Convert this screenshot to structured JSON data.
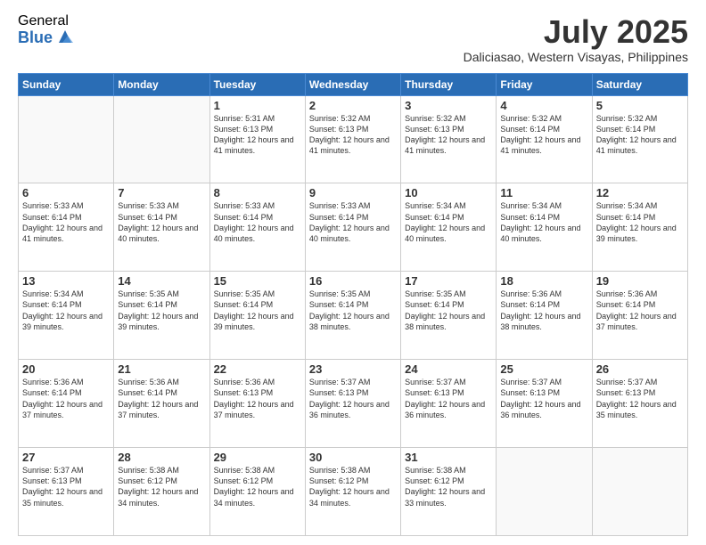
{
  "logo": {
    "general": "General",
    "blue": "Blue"
  },
  "title": {
    "month_year": "July 2025",
    "location": "Daliciasao, Western Visayas, Philippines"
  },
  "days_of_week": [
    "Sunday",
    "Monday",
    "Tuesday",
    "Wednesday",
    "Thursday",
    "Friday",
    "Saturday"
  ],
  "weeks": [
    [
      {
        "day": "",
        "sunrise": "",
        "sunset": "",
        "daylight": ""
      },
      {
        "day": "",
        "sunrise": "",
        "sunset": "",
        "daylight": ""
      },
      {
        "day": "1",
        "sunrise": "Sunrise: 5:31 AM",
        "sunset": "Sunset: 6:13 PM",
        "daylight": "Daylight: 12 hours and 41 minutes."
      },
      {
        "day": "2",
        "sunrise": "Sunrise: 5:32 AM",
        "sunset": "Sunset: 6:13 PM",
        "daylight": "Daylight: 12 hours and 41 minutes."
      },
      {
        "day": "3",
        "sunrise": "Sunrise: 5:32 AM",
        "sunset": "Sunset: 6:13 PM",
        "daylight": "Daylight: 12 hours and 41 minutes."
      },
      {
        "day": "4",
        "sunrise": "Sunrise: 5:32 AM",
        "sunset": "Sunset: 6:14 PM",
        "daylight": "Daylight: 12 hours and 41 minutes."
      },
      {
        "day": "5",
        "sunrise": "Sunrise: 5:32 AM",
        "sunset": "Sunset: 6:14 PM",
        "daylight": "Daylight: 12 hours and 41 minutes."
      }
    ],
    [
      {
        "day": "6",
        "sunrise": "Sunrise: 5:33 AM",
        "sunset": "Sunset: 6:14 PM",
        "daylight": "Daylight: 12 hours and 41 minutes."
      },
      {
        "day": "7",
        "sunrise": "Sunrise: 5:33 AM",
        "sunset": "Sunset: 6:14 PM",
        "daylight": "Daylight: 12 hours and 40 minutes."
      },
      {
        "day": "8",
        "sunrise": "Sunrise: 5:33 AM",
        "sunset": "Sunset: 6:14 PM",
        "daylight": "Daylight: 12 hours and 40 minutes."
      },
      {
        "day": "9",
        "sunrise": "Sunrise: 5:33 AM",
        "sunset": "Sunset: 6:14 PM",
        "daylight": "Daylight: 12 hours and 40 minutes."
      },
      {
        "day": "10",
        "sunrise": "Sunrise: 5:34 AM",
        "sunset": "Sunset: 6:14 PM",
        "daylight": "Daylight: 12 hours and 40 minutes."
      },
      {
        "day": "11",
        "sunrise": "Sunrise: 5:34 AM",
        "sunset": "Sunset: 6:14 PM",
        "daylight": "Daylight: 12 hours and 40 minutes."
      },
      {
        "day": "12",
        "sunrise": "Sunrise: 5:34 AM",
        "sunset": "Sunset: 6:14 PM",
        "daylight": "Daylight: 12 hours and 39 minutes."
      }
    ],
    [
      {
        "day": "13",
        "sunrise": "Sunrise: 5:34 AM",
        "sunset": "Sunset: 6:14 PM",
        "daylight": "Daylight: 12 hours and 39 minutes."
      },
      {
        "day": "14",
        "sunrise": "Sunrise: 5:35 AM",
        "sunset": "Sunset: 6:14 PM",
        "daylight": "Daylight: 12 hours and 39 minutes."
      },
      {
        "day": "15",
        "sunrise": "Sunrise: 5:35 AM",
        "sunset": "Sunset: 6:14 PM",
        "daylight": "Daylight: 12 hours and 39 minutes."
      },
      {
        "day": "16",
        "sunrise": "Sunrise: 5:35 AM",
        "sunset": "Sunset: 6:14 PM",
        "daylight": "Daylight: 12 hours and 38 minutes."
      },
      {
        "day": "17",
        "sunrise": "Sunrise: 5:35 AM",
        "sunset": "Sunset: 6:14 PM",
        "daylight": "Daylight: 12 hours and 38 minutes."
      },
      {
        "day": "18",
        "sunrise": "Sunrise: 5:36 AM",
        "sunset": "Sunset: 6:14 PM",
        "daylight": "Daylight: 12 hours and 38 minutes."
      },
      {
        "day": "19",
        "sunrise": "Sunrise: 5:36 AM",
        "sunset": "Sunset: 6:14 PM",
        "daylight": "Daylight: 12 hours and 37 minutes."
      }
    ],
    [
      {
        "day": "20",
        "sunrise": "Sunrise: 5:36 AM",
        "sunset": "Sunset: 6:14 PM",
        "daylight": "Daylight: 12 hours and 37 minutes."
      },
      {
        "day": "21",
        "sunrise": "Sunrise: 5:36 AM",
        "sunset": "Sunset: 6:14 PM",
        "daylight": "Daylight: 12 hours and 37 minutes."
      },
      {
        "day": "22",
        "sunrise": "Sunrise: 5:36 AM",
        "sunset": "Sunset: 6:13 PM",
        "daylight": "Daylight: 12 hours and 37 minutes."
      },
      {
        "day": "23",
        "sunrise": "Sunrise: 5:37 AM",
        "sunset": "Sunset: 6:13 PM",
        "daylight": "Daylight: 12 hours and 36 minutes."
      },
      {
        "day": "24",
        "sunrise": "Sunrise: 5:37 AM",
        "sunset": "Sunset: 6:13 PM",
        "daylight": "Daylight: 12 hours and 36 minutes."
      },
      {
        "day": "25",
        "sunrise": "Sunrise: 5:37 AM",
        "sunset": "Sunset: 6:13 PM",
        "daylight": "Daylight: 12 hours and 36 minutes."
      },
      {
        "day": "26",
        "sunrise": "Sunrise: 5:37 AM",
        "sunset": "Sunset: 6:13 PM",
        "daylight": "Daylight: 12 hours and 35 minutes."
      }
    ],
    [
      {
        "day": "27",
        "sunrise": "Sunrise: 5:37 AM",
        "sunset": "Sunset: 6:13 PM",
        "daylight": "Daylight: 12 hours and 35 minutes."
      },
      {
        "day": "28",
        "sunrise": "Sunrise: 5:38 AM",
        "sunset": "Sunset: 6:12 PM",
        "daylight": "Daylight: 12 hours and 34 minutes."
      },
      {
        "day": "29",
        "sunrise": "Sunrise: 5:38 AM",
        "sunset": "Sunset: 6:12 PM",
        "daylight": "Daylight: 12 hours and 34 minutes."
      },
      {
        "day": "30",
        "sunrise": "Sunrise: 5:38 AM",
        "sunset": "Sunset: 6:12 PM",
        "daylight": "Daylight: 12 hours and 34 minutes."
      },
      {
        "day": "31",
        "sunrise": "Sunrise: 5:38 AM",
        "sunset": "Sunset: 6:12 PM",
        "daylight": "Daylight: 12 hours and 33 minutes."
      },
      {
        "day": "",
        "sunrise": "",
        "sunset": "",
        "daylight": ""
      },
      {
        "day": "",
        "sunrise": "",
        "sunset": "",
        "daylight": ""
      }
    ]
  ]
}
